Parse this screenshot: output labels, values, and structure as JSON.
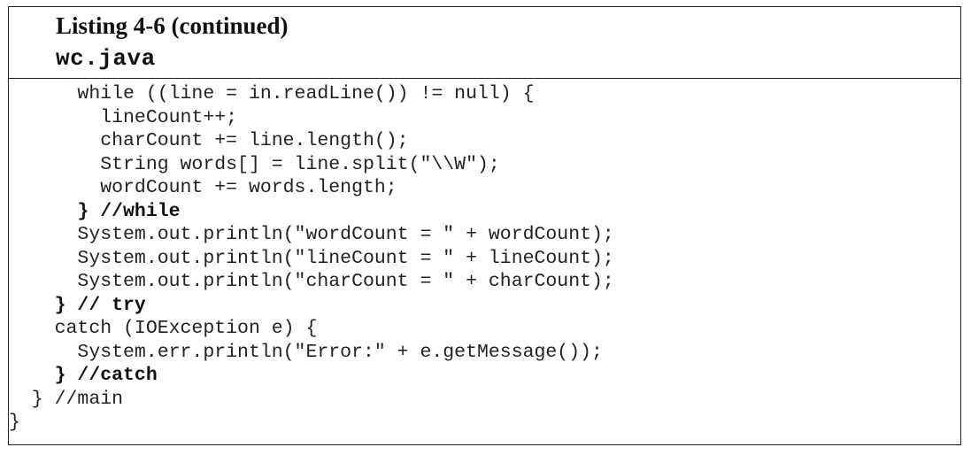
{
  "listing": {
    "title": "Listing 4-6 (continued)",
    "filename": "wc.java"
  },
  "code_lines": [
    {
      "text": "      while ((line = in.readLine()) != null) {",
      "bold": false
    },
    {
      "text": "        lineCount++;",
      "bold": false
    },
    {
      "text": "        charCount += line.length();",
      "bold": false
    },
    {
      "text": "        String words[] = line.split(\"\\\\W\");",
      "bold": false
    },
    {
      "text": "        wordCount += words.length;",
      "bold": false
    },
    {
      "text": "      } //while",
      "bold": true
    },
    {
      "text": "      System.out.println(\"wordCount = \" + wordCount);",
      "bold": false
    },
    {
      "text": "      System.out.println(\"lineCount = \" + lineCount);",
      "bold": false
    },
    {
      "text": "      System.out.println(\"charCount = \" + charCount);",
      "bold": false
    },
    {
      "text": "    } // try",
      "bold": true
    },
    {
      "text": "    catch (IOException e) {",
      "bold": false
    },
    {
      "text": "      System.err.println(\"Error:\" + e.getMessage());",
      "bold": false
    },
    {
      "text": "    } //catch",
      "bold": true
    },
    {
      "text": "  } //main",
      "bold": false
    },
    {
      "text": "}",
      "bold": false
    }
  ]
}
